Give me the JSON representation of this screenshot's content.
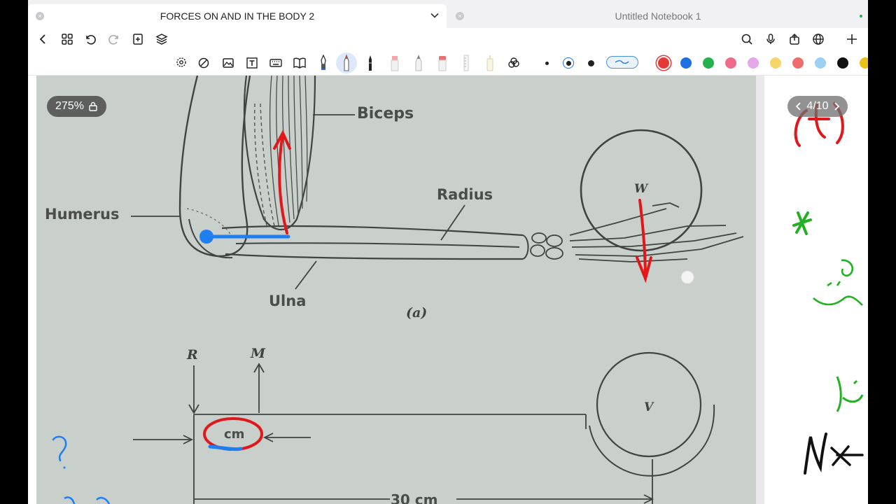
{
  "tabs": {
    "active_title": "FORCES ON AND IN THE BODY 2",
    "inactive_title": "Untitled Notebook 1"
  },
  "icons": {
    "nav": [
      "back-icon",
      "grid-icon",
      "undo-icon",
      "redo-icon",
      "add-page-icon",
      "layers-icon"
    ],
    "nav_right": [
      "search-icon",
      "microphone-icon",
      "share-icon",
      "globe-icon",
      "plus-icon"
    ],
    "tools": [
      "lasso-icon",
      "shapes-icon",
      "image-icon",
      "text-icon",
      "keyboard-icon",
      "book-icon",
      "fountain-pen-icon",
      "ballpoint-pen-icon",
      "brush-pen-icon",
      "highlighter-icon",
      "pencil-icon",
      "eraser-icon",
      "ruler-icon",
      "glue-icon",
      "laser-icon"
    ]
  },
  "colors": {
    "palette": [
      "#e53935",
      "#1e6fe0",
      "#22b14c",
      "#f06b8b",
      "#e5a8e8",
      "#f7d56b",
      "#ef6c6c",
      "#9ed0f5",
      "#111111",
      "#e8c21a"
    ],
    "selected": "#e53935",
    "ink_red": "#e0181b",
    "ink_blue": "#1f7ef0",
    "ink_green": "#22b120"
  },
  "zoom": {
    "label": "275%"
  },
  "pager": {
    "label": "4/10"
  },
  "scan": {
    "biceps": "Biceps",
    "radius": "Radius",
    "humerus": "Humerus",
    "ulna": "Ulna",
    "fig_a": "(a)",
    "w": "W",
    "r": "R",
    "m": "M",
    "v": "V",
    "dim_30": "30 cm"
  },
  "ink": {
    "cm": "cm",
    "question": "?",
    "star": "*",
    "right_m": "M"
  }
}
